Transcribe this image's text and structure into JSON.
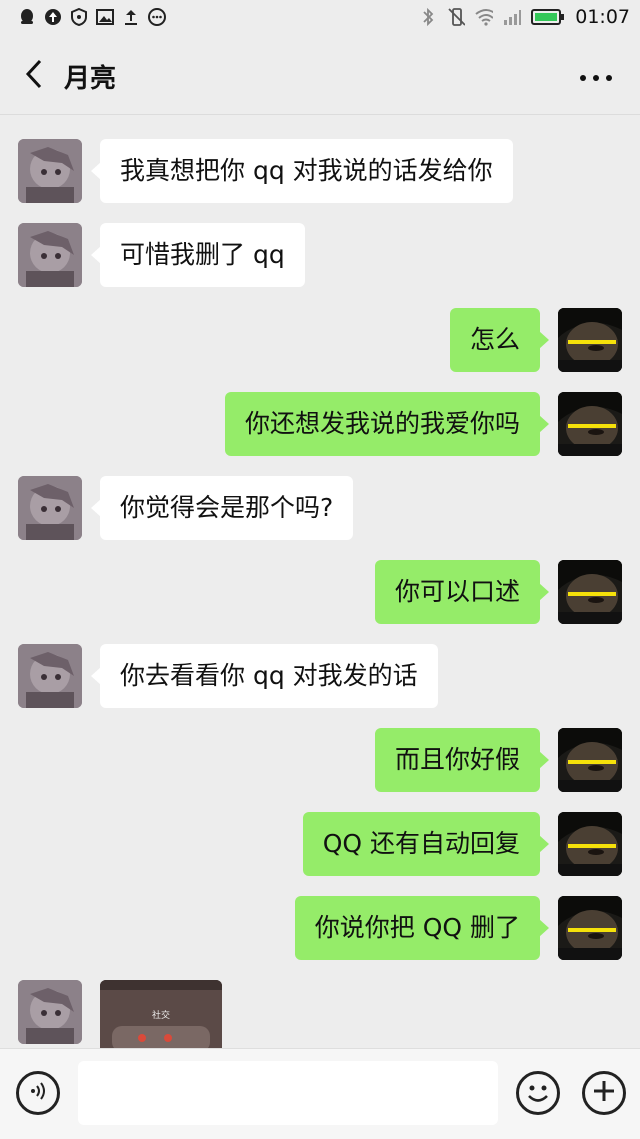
{
  "status_bar": {
    "time": "01:07",
    "battery_color": "#34c759"
  },
  "header": {
    "title": "月亮"
  },
  "messages": [
    {
      "side": "peer",
      "text": "我真想把你 qq 对我说的话发给你"
    },
    {
      "side": "peer",
      "text": "可惜我删了 qq"
    },
    {
      "side": "me",
      "text": "怎么"
    },
    {
      "side": "me",
      "text": "你还想发我说的我爱你吗"
    },
    {
      "side": "peer",
      "text": "你觉得会是那个吗?"
    },
    {
      "side": "me",
      "text": "你可以口述"
    },
    {
      "side": "peer",
      "text": "你去看看你 qq 对我发的话"
    },
    {
      "side": "me",
      "text": "而且你好假"
    },
    {
      "side": "me",
      "text": "QQ 还有自动回复"
    },
    {
      "side": "me",
      "text": "你说你把 QQ 删了"
    }
  ],
  "image_message": {
    "caption": "社交"
  },
  "colors": {
    "bubble_me": "#95ec69",
    "bubble_peer": "#ffffff",
    "background": "#ededed"
  }
}
